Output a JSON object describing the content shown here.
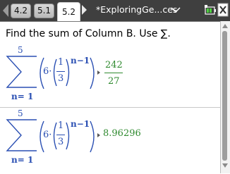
{
  "tabs": [
    {
      "label": "4.2",
      "active": false
    },
    {
      "label": "5.1",
      "active": false
    },
    {
      "label": "5.2",
      "active": true
    }
  ],
  "document_title": "*ExploringGe...ces",
  "prompt_text": "Find the sum of Column B. Use ∑.",
  "expressions": [
    {
      "upper_limit": "5",
      "lower_limit": "n= 1",
      "coefficient": "6·",
      "fraction_num": "1",
      "fraction_den": "3",
      "exponent": "n−1",
      "result_num": "242",
      "result_den": "27"
    },
    {
      "upper_limit": "5",
      "lower_limit": "n= 1",
      "coefficient": "6·",
      "fraction_num": "1",
      "fraction_den": "3",
      "exponent": "n−1",
      "result_value": "8.96296"
    }
  ],
  "colors": {
    "math_blue": "#2a4fb3",
    "result_green": "#2f8a2f",
    "titlebar": "#3f3f3f"
  },
  "icons": [
    "nav-left-arrow",
    "nav-right-arrow",
    "chevron-down-icon",
    "battery-icon",
    "close-icon"
  ]
}
